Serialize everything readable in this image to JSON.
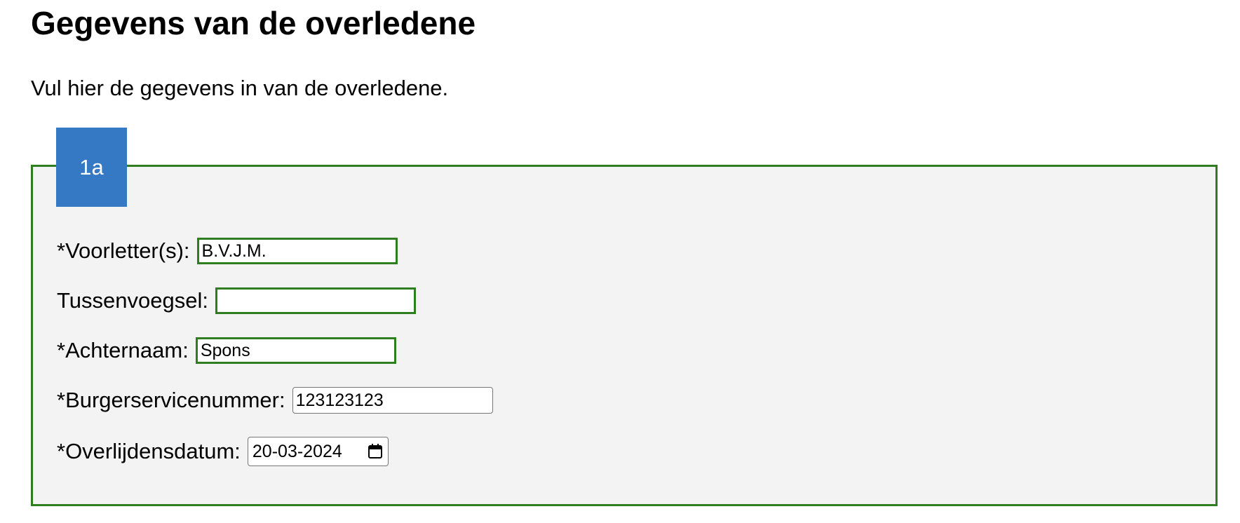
{
  "page": {
    "title": "Gegevens van de overledene",
    "intro": "Vul hier de gegevens in van de overledene."
  },
  "section": {
    "legend": "1a",
    "accent_color": "#2e7d1f",
    "legend_color": "#3578c4",
    "fields": {
      "voorletters": {
        "label": "*Voorletter(s):",
        "value": "B.V.J.M."
      },
      "tussenvoegsel": {
        "label": "Tussenvoegsel:",
        "value": ""
      },
      "achternaam": {
        "label": "*Achternaam:",
        "value": "Spons"
      },
      "bsn": {
        "label": "*Burgerservicenummer:",
        "value": "123123123"
      },
      "overlijdensdatum": {
        "label": "*Overlijdensdatum:",
        "value": "20-03-2024",
        "icon": "calendar-icon"
      }
    }
  }
}
